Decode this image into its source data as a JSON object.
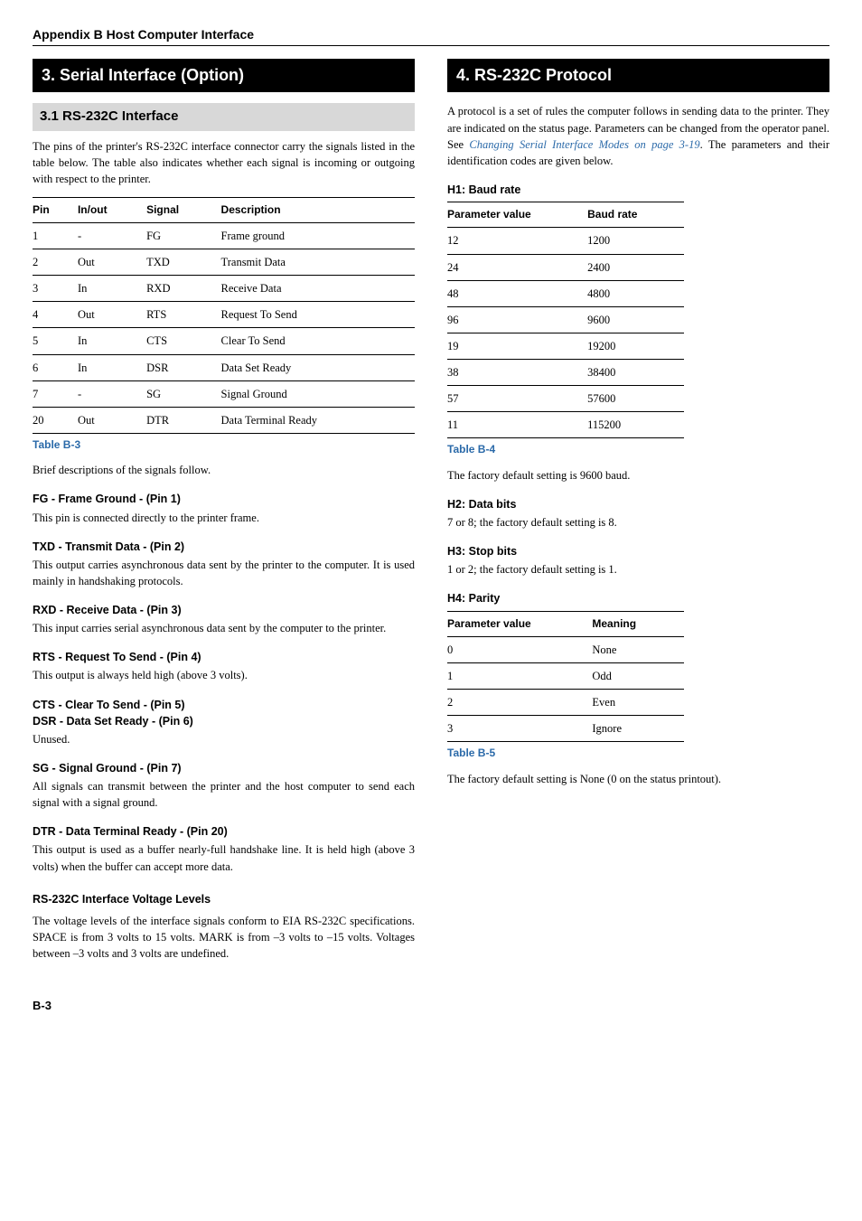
{
  "header": "Appendix B  Host Computer Interface",
  "footer": "B-3",
  "left": {
    "section_title": "3. Serial Interface (Option)",
    "sub_title": "3.1 RS-232C Interface",
    "intro": "The pins of the printer's RS-232C interface connector carry the signals listed in the table below. The table also indicates whether each signal is incoming or outgoing with respect to the printer.",
    "table": {
      "head": {
        "pin": "Pin",
        "inout": "In/out",
        "signal": "Signal",
        "desc": "Description"
      },
      "rows": [
        {
          "pin": "1",
          "inout": "-",
          "signal": "FG",
          "desc": "Frame ground"
        },
        {
          "pin": "2",
          "inout": "Out",
          "signal": "TXD",
          "desc": "Transmit Data"
        },
        {
          "pin": "3",
          "inout": "In",
          "signal": "RXD",
          "desc": "Receive Data"
        },
        {
          "pin": "4",
          "inout": "Out",
          "signal": "RTS",
          "desc": "Request To Send"
        },
        {
          "pin": "5",
          "inout": "In",
          "signal": "CTS",
          "desc": "Clear To Send"
        },
        {
          "pin": "6",
          "inout": "In",
          "signal": "DSR",
          "desc": "Data Set Ready"
        },
        {
          "pin": "7",
          "inout": "-",
          "signal": "SG",
          "desc": "Signal Ground"
        },
        {
          "pin": "20",
          "inout": "Out",
          "signal": "DTR",
          "desc": "Data Terminal Ready"
        }
      ],
      "caption": "Table B-3"
    },
    "brief": "Brief descriptions of the signals follow.",
    "signals": [
      {
        "head": "FG - Frame Ground - (Pin 1)",
        "body": "This pin is connected directly to the printer frame."
      },
      {
        "head": "TXD - Transmit Data - (Pin 2)",
        "body": "This output carries asynchronous data sent by the printer to the computer. It is used mainly in handshaking protocols."
      },
      {
        "head": "RXD - Receive Data - (Pin 3)",
        "body": "This input carries serial asynchronous data sent by the computer to the printer."
      },
      {
        "head": "RTS - Request To Send - (Pin 4)",
        "body": "This output is always held high (above 3 volts)."
      }
    ],
    "cts_head": "CTS - Clear To Send - (Pin 5)",
    "dsr_head": "DSR - Data Set Ready - (Pin 6)",
    "cts_dsr_body": "Unused.",
    "sg_head": "SG - Signal Ground - (Pin 7)",
    "sg_body": "All signals can transmit between the printer and the host computer to send each signal with a signal ground.",
    "dtr_head": "DTR - Data Terminal Ready - (Pin 20)",
    "dtr_body": "This output is used as a buffer nearly-full handshake line. It is held high (above 3 volts) when the buffer can accept more data.",
    "volt_head": "RS-232C Interface Voltage Levels",
    "volt_body": "The voltage levels of the interface signals conform to EIA RS-232C specifications. SPACE is from 3 volts to 15 volts. MARK is from –3 volts to –15 volts. Voltages between –3 volts and 3 volts are undefined."
  },
  "right": {
    "section_title": "4. RS-232C Protocol",
    "intro_pre": "A protocol is a set of rules the computer follows in sending data to the printer. They are indicated on the status page. Parameters can be changed from the operator panel. See ",
    "intro_link": "Changing Serial Interface Modes on page 3-19",
    "intro_post": ". The parameters and their identification codes are given below.",
    "h1_head": "H1: Baud rate",
    "baud": {
      "head": {
        "param": "Parameter value",
        "rate": "Baud rate"
      },
      "rows": [
        {
          "param": "12",
          "rate": "1200"
        },
        {
          "param": "24",
          "rate": "2400"
        },
        {
          "param": "48",
          "rate": "4800"
        },
        {
          "param": "96",
          "rate": "9600"
        },
        {
          "param": "19",
          "rate": "19200"
        },
        {
          "param": "38",
          "rate": "38400"
        },
        {
          "param": "57",
          "rate": "57600"
        },
        {
          "param": "11",
          "rate": "115200"
        }
      ],
      "caption": "Table B-4"
    },
    "baud_default": "The factory default setting is 9600 baud.",
    "h2_head": "H2: Data bits",
    "h2_body": "7 or 8; the factory default setting is 8.",
    "h3_head": "H3: Stop bits",
    "h3_body": "1 or 2; the factory default setting is 1.",
    "h4_head": "H4: Parity",
    "parity": {
      "head": {
        "param": "Parameter value",
        "meaning": "Meaning"
      },
      "rows": [
        {
          "param": "0",
          "meaning": "None"
        },
        {
          "param": "1",
          "meaning": "Odd"
        },
        {
          "param": "2",
          "meaning": "Even"
        },
        {
          "param": "3",
          "meaning": "Ignore"
        }
      ],
      "caption": "Table B-5"
    },
    "parity_default": "The factory default setting is None (0 on the status printout)."
  }
}
